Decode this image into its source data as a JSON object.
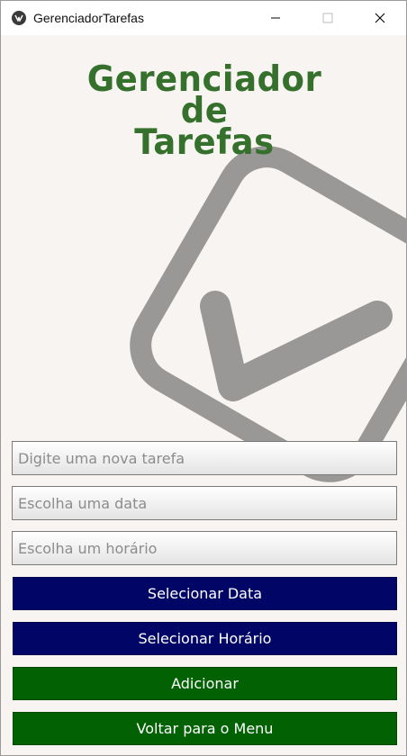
{
  "window": {
    "title": "GerenciadorTarefas",
    "minimize_icon": "minimize-icon",
    "maximize_icon": "maximize-icon",
    "close_icon": "close-icon"
  },
  "heading": {
    "line1": "Gerenciador",
    "line2": "de",
    "line3": "Tarefas",
    "color": "#35712c"
  },
  "background": {
    "icon": "checkbox-check-icon",
    "color": "#9a9896"
  },
  "form": {
    "task_placeholder": "Digite uma nova tarefa",
    "date_placeholder": "Escolha uma data",
    "time_placeholder": "Escolha um horário"
  },
  "buttons": {
    "select_date": "Selecionar Data",
    "select_time": "Selecionar Horário",
    "add": "Adicionar",
    "back": "Voltar para o Menu"
  },
  "colors": {
    "navy": "#010566",
    "green": "#016103",
    "background": "#f7f4f1"
  }
}
